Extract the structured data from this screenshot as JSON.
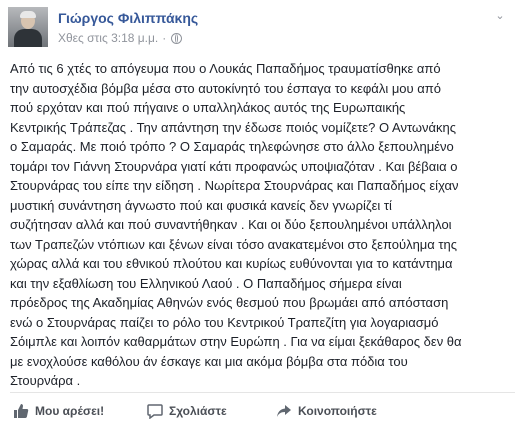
{
  "post": {
    "author": "Γιώργος Φιλιππάκης",
    "timestamp": "Χθες στις 3:18 μ.μ.",
    "separator": "·",
    "menu_glyph": "⌄",
    "text_lines": [
      "Από τις 6 χτές το απόγευμα που ο Λουκάς Παπαδήμος τραυματίσθηκε από",
      "την αυτοσχέδια βόμβα μέσα στο αυτοκίνητό του έσπαγα το κεφάλι μου από",
      "πού ερχόταν και πού πήγαινε ο υπαλληλάκος αυτός της Ευρωπαικής",
      "Κεντρικής Τράπεζας . Την απάντηση την έδωσε ποιός νομίζετε? Ο Αντωνάκης",
      "ο Σαμαράς. Με ποιό τρόπο ? Ο Σαμαράς τηλεφώνησε στο άλλο ξεπουλημένο",
      "τομάρι τον Γιάννη Στουρνάρα γιατί κάτι προφανώς υποψιαζόταν . Και βέβαια ο",
      "Στουρνάρας του είπε την είδηση . Νωρίτερα Στουρνάρας και Παπαδήμος είχαν",
      "μυστική συνάντηση άγνωστο πού και φυσικά κανείς δεν γνωρίζει τί",
      "συζήτησαν αλλά και πού συναντήθηκαν . Και οι δύο ξεπουλημένοι υπάλληλοι",
      "των Τραπεζών ντόπιων και ξένων είναι τόσο ανακατεμένοι στο ξεπούλημα της",
      "χώρας αλλά και του εθνικού πλούτου και κυρίως ευθύνονται για το κατάντημα",
      "και την εξαθλίωση του Ελληνικού Λαού . Ο Παπαδήμος σήμερα είναι",
      "πρόεδρος της Ακαδημίας Αθηνών ενός θεσμού που βρωμάει από απόσταση",
      "ενώ ο Στουρνάρας παίζει το ρόλο του Κεντρικού Τραπεζίτη για λογαριασμό",
      "Σόιμπλε και λοιπόν καθαρμάτων στην Ευρώπη . Για να είμαι ξεκάθαρος δεν θα",
      "με ενοχλούσε καθόλου άν έσκαγε και μια ακόμα βόμβα στα πόδια του",
      "Στουρνάρα ."
    ]
  },
  "actions": {
    "like": {
      "label": "Μου αρέσει!",
      "icon": "thumbs-up-icon"
    },
    "comment": {
      "label": "Σχολιάστε",
      "icon": "comment-icon"
    },
    "share": {
      "label": "Κοινοποιήστε",
      "icon": "share-icon"
    }
  },
  "colors": {
    "author_link": "#365899",
    "meta_gray": "#90949c",
    "body_text": "#1d2129",
    "action_text": "#4b4f56"
  }
}
